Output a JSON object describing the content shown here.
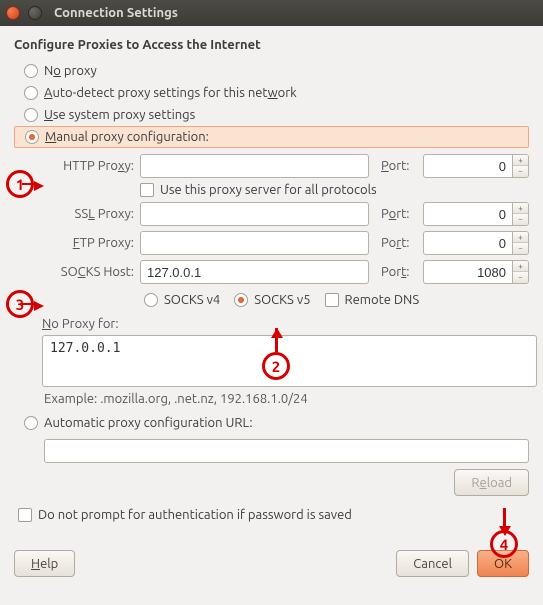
{
  "window": {
    "title": "Connection Settings"
  },
  "heading": "Configure Proxies to Access the Internet",
  "radios": {
    "no_proxy": "No proxy",
    "auto_detect": "Auto-detect proxy settings for this network",
    "system": "Use system proxy settings",
    "manual": "Manual proxy configuration:",
    "auto_url": "Automatic proxy configuration URL:"
  },
  "labels": {
    "http": "HTTP Proxy:",
    "ssl": "SSL Proxy:",
    "ftp": "FTP Proxy:",
    "socks": "SOCKS Host:",
    "port": "Port:",
    "use_all": "Use this proxy server for all protocols",
    "socks_v4": "SOCKS v4",
    "socks_v5": "SOCKS v5",
    "remote_dns": "Remote DNS",
    "no_proxy_for": "No Proxy for:",
    "example": "Example: .mozilla.org, .net.nz, 192.168.1.0/24",
    "no_prompt": "Do not prompt for authentication if password is saved"
  },
  "values": {
    "http_host": "",
    "http_port": "0",
    "ssl_host": "",
    "ssl_port": "0",
    "ftp_host": "",
    "ftp_port": "0",
    "socks_host": "127.0.0.1",
    "socks_port": "1080",
    "no_proxy": "127.0.0.1",
    "auto_url": ""
  },
  "buttons": {
    "reload": "Reload",
    "help": "Help",
    "cancel": "Cancel",
    "ok": "OK"
  },
  "annotations": {
    "1": "1",
    "2": "2",
    "3": "3",
    "4": "4"
  }
}
